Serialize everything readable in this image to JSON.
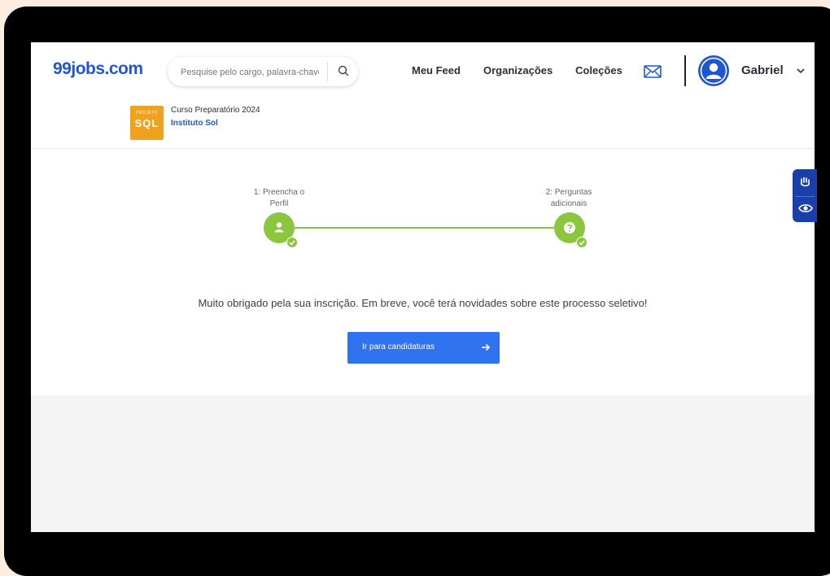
{
  "header": {
    "logo": "99jobs.com",
    "search_placeholder": "Pesquise pelo cargo, palavra-chave",
    "nav": [
      "Meu Feed",
      "Organizações",
      "Coleções"
    ],
    "user_name": "Gabriel"
  },
  "course": {
    "logo_small": "PROJETO",
    "logo_big": "SQL",
    "title": "Curso Preparatório 2024",
    "organization": "Instituto Sol"
  },
  "steps": [
    {
      "label_line1": "1: Preencha o",
      "label_line2": "Perfil",
      "icon": "user-icon",
      "completed": true
    },
    {
      "label_line1": "2: Perguntas",
      "label_line2": "adicionais",
      "icon": "question-icon",
      "completed": true
    }
  ],
  "message": "Muito obrigado pela sua inscrição. Em breve, você terá novidades sobre este processo seletivo!",
  "cta": {
    "label": "Ir para candidaturas",
    "icon": "arrow-right-icon"
  },
  "accessibility": {
    "icons": [
      "sign-language-icon",
      "eye-icon"
    ]
  },
  "colors": {
    "brand": "#1f56d6",
    "success": "#8cc63f",
    "button": "#2f73f0",
    "course_logo": "#f0a11e",
    "a11y": "#1b3fa8"
  }
}
